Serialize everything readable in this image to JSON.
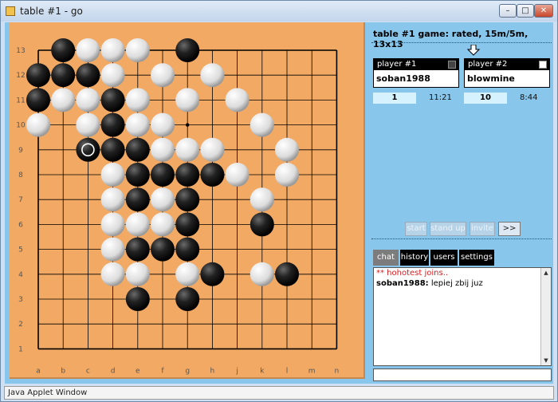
{
  "window": {
    "title": "table #1 - go",
    "min": "–",
    "max": "□",
    "close": "✕"
  },
  "board": {
    "size": 13,
    "col_labels": [
      "a",
      "b",
      "c",
      "d",
      "e",
      "f",
      "g",
      "h",
      "j",
      "k",
      "l",
      "m",
      "n"
    ],
    "row_labels": [
      "13",
      "12",
      "11",
      "10",
      "9",
      "8",
      "7",
      "6",
      "5",
      "4",
      "3",
      "2",
      "1"
    ],
    "last_move": "c9",
    "star_points": [
      "g10"
    ],
    "black_stones": [
      "b13",
      "g13",
      "a12",
      "b12",
      "c12",
      "a11",
      "d11",
      "d10",
      "c9",
      "d9",
      "e9",
      "e8",
      "f8",
      "g8",
      "h8",
      "e7",
      "g7",
      "g6",
      "k6",
      "e5",
      "f5",
      "g5",
      "h4",
      "l4",
      "e3",
      "g3"
    ],
    "white_stones": [
      "c13",
      "d13",
      "e13",
      "d12",
      "f12",
      "h12",
      "b11",
      "c11",
      "e11",
      "g11",
      "j11",
      "a10",
      "c10",
      "e10",
      "f10",
      "k10",
      "f9",
      "g9",
      "h9",
      "l9",
      "d8",
      "j8",
      "l8",
      "d7",
      "f7",
      "k7",
      "d6",
      "e6",
      "f6",
      "d5",
      "d4",
      "e4",
      "g4",
      "k4"
    ]
  },
  "panel": {
    "table_label": "table #1",
    "game_info": "game: rated, 15m/5m, 13x13",
    "player1": {
      "label": "player #1",
      "name": "soban1988",
      "color": "black",
      "captures": "1",
      "time": "11:21"
    },
    "player2": {
      "label": "player #2",
      "name": "blowmine",
      "color": "white",
      "captures": "10",
      "time": "8:44"
    },
    "buttons": {
      "start": "start",
      "stand_up": "stand up",
      "invite": "invite",
      "more": ">>"
    },
    "tabs": [
      "chat",
      "history",
      "users",
      "settings"
    ],
    "active_tab": "chat",
    "chat": [
      {
        "type": "system",
        "text": "** hohotest joins.."
      },
      {
        "type": "user",
        "user": "soban1988:",
        "text": "lepiej zbij juz"
      }
    ]
  },
  "status_bar": "Java Applet Window"
}
